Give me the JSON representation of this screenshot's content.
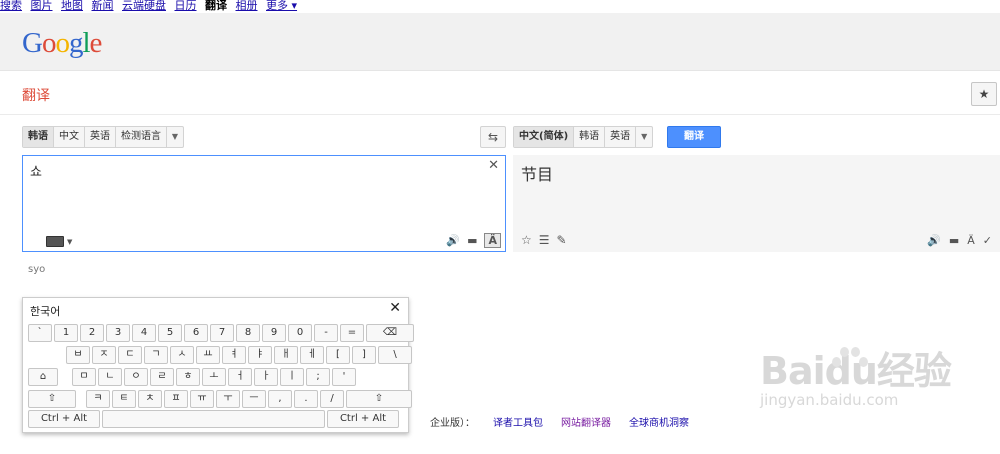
{
  "topnav": {
    "items": [
      "搜索",
      "图片",
      "地图",
      "新闻",
      "云端硬盘",
      "日历",
      "翻译",
      "相册"
    ],
    "active_index": 6,
    "more_label": "更多 ▾"
  },
  "header": {
    "logo": "Google"
  },
  "app": {
    "title": "翻译"
  },
  "source_langs": {
    "items": [
      "韩语",
      "中文",
      "英语",
      "检测语言"
    ],
    "selected": "韩语"
  },
  "target_langs": {
    "items": [
      "中文(简体)",
      "韩语",
      "英语"
    ],
    "selected": "中文(简体)"
  },
  "translate_button": "翻译",
  "source": {
    "text": "쇼",
    "transliteration": "syo"
  },
  "target": {
    "text": "节目"
  },
  "virtual_keyboard": {
    "title": "한국어",
    "row1": [
      "`",
      "1",
      "2",
      "3",
      "4",
      "5",
      "6",
      "7",
      "8",
      "9",
      "0",
      "-",
      "="
    ],
    "backspace": "⌫",
    "row2": [
      "ㅂ",
      "ㅈ",
      "ㄷ",
      "ㄱ",
      "ㅅ",
      "ㅛ",
      "ㅕ",
      "ㅑ",
      "ㅐ",
      "ㅔ",
      "[",
      "]",
      "\\"
    ],
    "caps": "⌂",
    "row3": [
      "ㅁ",
      "ㄴ",
      "ㅇ",
      "ㄹ",
      "ㅎ",
      "ㅗ",
      "ㅓ",
      "ㅏ",
      "ㅣ",
      ";",
      "'"
    ],
    "shift": "⇧",
    "row4": [
      "ㅋ",
      "ㅌ",
      "ㅊ",
      "ㅍ",
      "ㅠ",
      "ㅜ",
      "ㅡ",
      ",",
      ".",
      "/"
    ],
    "alt_label": "Ctrl + Alt"
  },
  "footer": {
    "prefix": "企业版）：",
    "links": [
      "译者工具包",
      "网站翻译器",
      "全球商机洞察"
    ]
  },
  "watermark": {
    "brand": "Baidu经验",
    "url": "jingyan.baidu.com"
  }
}
